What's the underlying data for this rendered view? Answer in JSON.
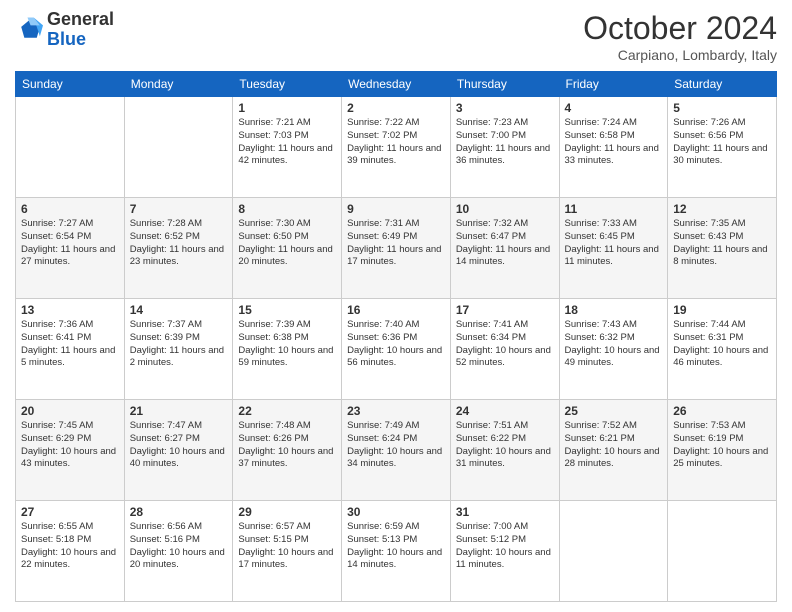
{
  "header": {
    "logo_line1": "General",
    "logo_line2": "Blue",
    "month": "October 2024",
    "location": "Carpiano, Lombardy, Italy"
  },
  "days": [
    "Sunday",
    "Monday",
    "Tuesday",
    "Wednesday",
    "Thursday",
    "Friday",
    "Saturday"
  ],
  "weeks": [
    [
      {
        "day": "",
        "text": ""
      },
      {
        "day": "",
        "text": ""
      },
      {
        "day": "1",
        "text": "Sunrise: 7:21 AM\nSunset: 7:03 PM\nDaylight: 11 hours and 42 minutes."
      },
      {
        "day": "2",
        "text": "Sunrise: 7:22 AM\nSunset: 7:02 PM\nDaylight: 11 hours and 39 minutes."
      },
      {
        "day": "3",
        "text": "Sunrise: 7:23 AM\nSunset: 7:00 PM\nDaylight: 11 hours and 36 minutes."
      },
      {
        "day": "4",
        "text": "Sunrise: 7:24 AM\nSunset: 6:58 PM\nDaylight: 11 hours and 33 minutes."
      },
      {
        "day": "5",
        "text": "Sunrise: 7:26 AM\nSunset: 6:56 PM\nDaylight: 11 hours and 30 minutes."
      }
    ],
    [
      {
        "day": "6",
        "text": "Sunrise: 7:27 AM\nSunset: 6:54 PM\nDaylight: 11 hours and 27 minutes."
      },
      {
        "day": "7",
        "text": "Sunrise: 7:28 AM\nSunset: 6:52 PM\nDaylight: 11 hours and 23 minutes."
      },
      {
        "day": "8",
        "text": "Sunrise: 7:30 AM\nSunset: 6:50 PM\nDaylight: 11 hours and 20 minutes."
      },
      {
        "day": "9",
        "text": "Sunrise: 7:31 AM\nSunset: 6:49 PM\nDaylight: 11 hours and 17 minutes."
      },
      {
        "day": "10",
        "text": "Sunrise: 7:32 AM\nSunset: 6:47 PM\nDaylight: 11 hours and 14 minutes."
      },
      {
        "day": "11",
        "text": "Sunrise: 7:33 AM\nSunset: 6:45 PM\nDaylight: 11 hours and 11 minutes."
      },
      {
        "day": "12",
        "text": "Sunrise: 7:35 AM\nSunset: 6:43 PM\nDaylight: 11 hours and 8 minutes."
      }
    ],
    [
      {
        "day": "13",
        "text": "Sunrise: 7:36 AM\nSunset: 6:41 PM\nDaylight: 11 hours and 5 minutes."
      },
      {
        "day": "14",
        "text": "Sunrise: 7:37 AM\nSunset: 6:39 PM\nDaylight: 11 hours and 2 minutes."
      },
      {
        "day": "15",
        "text": "Sunrise: 7:39 AM\nSunset: 6:38 PM\nDaylight: 10 hours and 59 minutes."
      },
      {
        "day": "16",
        "text": "Sunrise: 7:40 AM\nSunset: 6:36 PM\nDaylight: 10 hours and 56 minutes."
      },
      {
        "day": "17",
        "text": "Sunrise: 7:41 AM\nSunset: 6:34 PM\nDaylight: 10 hours and 52 minutes."
      },
      {
        "day": "18",
        "text": "Sunrise: 7:43 AM\nSunset: 6:32 PM\nDaylight: 10 hours and 49 minutes."
      },
      {
        "day": "19",
        "text": "Sunrise: 7:44 AM\nSunset: 6:31 PM\nDaylight: 10 hours and 46 minutes."
      }
    ],
    [
      {
        "day": "20",
        "text": "Sunrise: 7:45 AM\nSunset: 6:29 PM\nDaylight: 10 hours and 43 minutes."
      },
      {
        "day": "21",
        "text": "Sunrise: 7:47 AM\nSunset: 6:27 PM\nDaylight: 10 hours and 40 minutes."
      },
      {
        "day": "22",
        "text": "Sunrise: 7:48 AM\nSunset: 6:26 PM\nDaylight: 10 hours and 37 minutes."
      },
      {
        "day": "23",
        "text": "Sunrise: 7:49 AM\nSunset: 6:24 PM\nDaylight: 10 hours and 34 minutes."
      },
      {
        "day": "24",
        "text": "Sunrise: 7:51 AM\nSunset: 6:22 PM\nDaylight: 10 hours and 31 minutes."
      },
      {
        "day": "25",
        "text": "Sunrise: 7:52 AM\nSunset: 6:21 PM\nDaylight: 10 hours and 28 minutes."
      },
      {
        "day": "26",
        "text": "Sunrise: 7:53 AM\nSunset: 6:19 PM\nDaylight: 10 hours and 25 minutes."
      }
    ],
    [
      {
        "day": "27",
        "text": "Sunrise: 6:55 AM\nSunset: 5:18 PM\nDaylight: 10 hours and 22 minutes."
      },
      {
        "day": "28",
        "text": "Sunrise: 6:56 AM\nSunset: 5:16 PM\nDaylight: 10 hours and 20 minutes."
      },
      {
        "day": "29",
        "text": "Sunrise: 6:57 AM\nSunset: 5:15 PM\nDaylight: 10 hours and 17 minutes."
      },
      {
        "day": "30",
        "text": "Sunrise: 6:59 AM\nSunset: 5:13 PM\nDaylight: 10 hours and 14 minutes."
      },
      {
        "day": "31",
        "text": "Sunrise: 7:00 AM\nSunset: 5:12 PM\nDaylight: 10 hours and 11 minutes."
      },
      {
        "day": "",
        "text": ""
      },
      {
        "day": "",
        "text": ""
      }
    ]
  ]
}
